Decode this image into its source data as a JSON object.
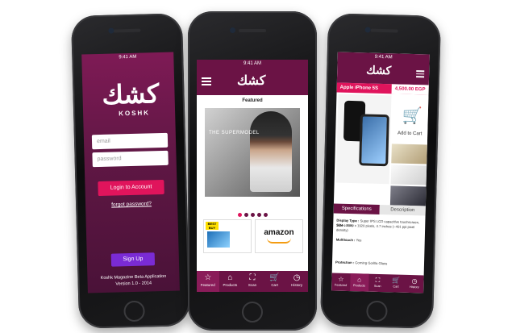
{
  "login_screen": {
    "status_time": "9:41 AM",
    "logo_glyph": "كشك",
    "logo_word": "KOSHK",
    "email_placeholder": "email",
    "password_placeholder": "password",
    "login_button": "Login to Account",
    "forgot_link": "forgot password?",
    "signup_button": "Sign Up",
    "footer_line1": "Koshk Magazine Beta Application",
    "footer_line2": "Version 1.0 - 2014"
  },
  "featured_screen": {
    "status_time": "9:41 AM",
    "logo_glyph": "كشك",
    "section_title": "Featured",
    "hero_text": "THE SUPERMODEL",
    "ad_left_brand": "BEST BUY",
    "ad_right_brand": "amazon",
    "tabs": [
      {
        "label": "Featured",
        "icon": "star-icon",
        "glyph": "☆"
      },
      {
        "label": "Products",
        "icon": "tag-icon",
        "glyph": "⌂"
      },
      {
        "label": "Scan",
        "icon": "scan-icon",
        "glyph": "⛶"
      },
      {
        "label": "Cart",
        "icon": "cart-icon",
        "glyph": "🛒"
      },
      {
        "label": "History",
        "icon": "clock-icon",
        "glyph": "◷"
      }
    ]
  },
  "product_screen": {
    "status_time": "9:41 AM",
    "logo_glyph": "كشك",
    "product_name": "Apple iPhone 5S",
    "product_price": "4,500.00 EGP",
    "add_to_cart": "Add to Cart",
    "tab_specifications": "Specifications",
    "tab_description": "Description",
    "spec_display_label": "Display Type :",
    "spec_display_value": "Super IPS LCD capacitive touchscreen, 16M colors",
    "spec_size_label": "Size :",
    "spec_size_value": "1080 x 1920 pixels, 4.7 inches (~401 ppi pixel density)",
    "spec_multitouch_label": "Multitouch :",
    "spec_multitouch_value": "Yes",
    "spec_protection_label": "Protection :",
    "spec_protection_value": "Corning Gorilla Glass",
    "tabs": [
      {
        "label": "Featured",
        "glyph": "☆"
      },
      {
        "label": "Products",
        "glyph": "⌂"
      },
      {
        "label": "Scan",
        "glyph": "⛶"
      },
      {
        "label": "Cart",
        "glyph": "🛒"
      },
      {
        "label": "History",
        "glyph": "◷"
      }
    ]
  },
  "colors": {
    "brand_plum": "#6b1345",
    "accent_pink": "#e0145c",
    "signup_purple": "#7a2bd4"
  }
}
